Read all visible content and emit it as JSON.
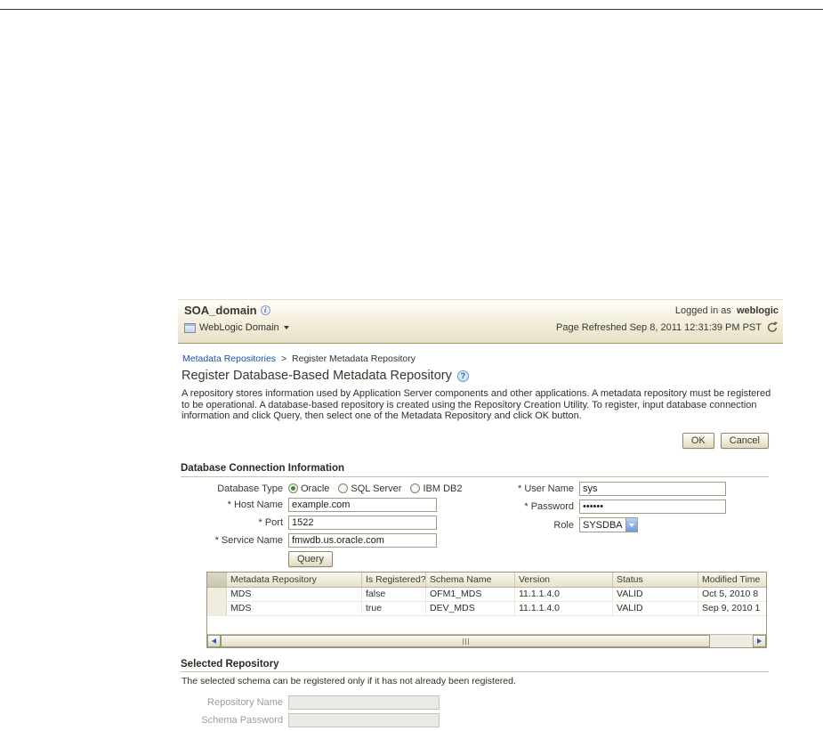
{
  "header": {
    "domain_title": "SOA_domain",
    "menu_label": "WebLogic Domain",
    "logged_in_prefix": "Logged in as",
    "logged_in_user": "weblogic",
    "refreshed_text": "Page Refreshed Sep 8, 2011 12:31:39 PM PST"
  },
  "breadcrumb": {
    "link_label": "Metadata Repositories",
    "separator": ">",
    "current": "Register Metadata Repository"
  },
  "page": {
    "title": "Register Database-Based Metadata Repository",
    "description": "A repository stores information used by Application Server components and other applications. A metadata repository must be registered to be operational. A database-based repository is created using the Repository Creation Utility. To register, input database connection information and click Query, then select one of the Metadata Repository and click OK button.",
    "ok_label": "OK",
    "cancel_label": "Cancel"
  },
  "connection": {
    "section_title": "Database Connection Information",
    "database_type_label": "Database Type",
    "db_options": [
      {
        "label": "Oracle",
        "selected": true
      },
      {
        "label": "SQL Server",
        "selected": false
      },
      {
        "label": "IBM DB2",
        "selected": false
      }
    ],
    "host_label": "* Host Name",
    "host_value": "example.com",
    "port_label": "* Port",
    "port_value": "1522",
    "service_label": "* Service Name",
    "service_value": "fmwdb.us.oracle.com",
    "query_label": "Query",
    "user_label": "* User Name",
    "user_value": "sys",
    "password_label": "* Password",
    "password_value": "••••••",
    "role_label": "Role",
    "role_value": "SYSDBA"
  },
  "repository_table": {
    "columns": [
      "Metadata Repository",
      "Is Registered?",
      "Schema Name",
      "Version",
      "Status",
      "Modified Time"
    ],
    "rows": [
      [
        "MDS",
        "false",
        "OFM1_MDS",
        "11.1.1.4.0",
        "VALID",
        "Oct 5, 2010 8"
      ],
      [
        "MDS",
        "true",
        "DEV_MDS",
        "11.1.1.4.0",
        "VALID",
        "Sep 9, 2010 1"
      ]
    ]
  },
  "selected_repository": {
    "section_title": "Selected Repository",
    "note": "The selected schema can be registered only if it has not already been registered.",
    "repository_name_label": "Repository Name",
    "schema_password_label": "Schema Password"
  }
}
